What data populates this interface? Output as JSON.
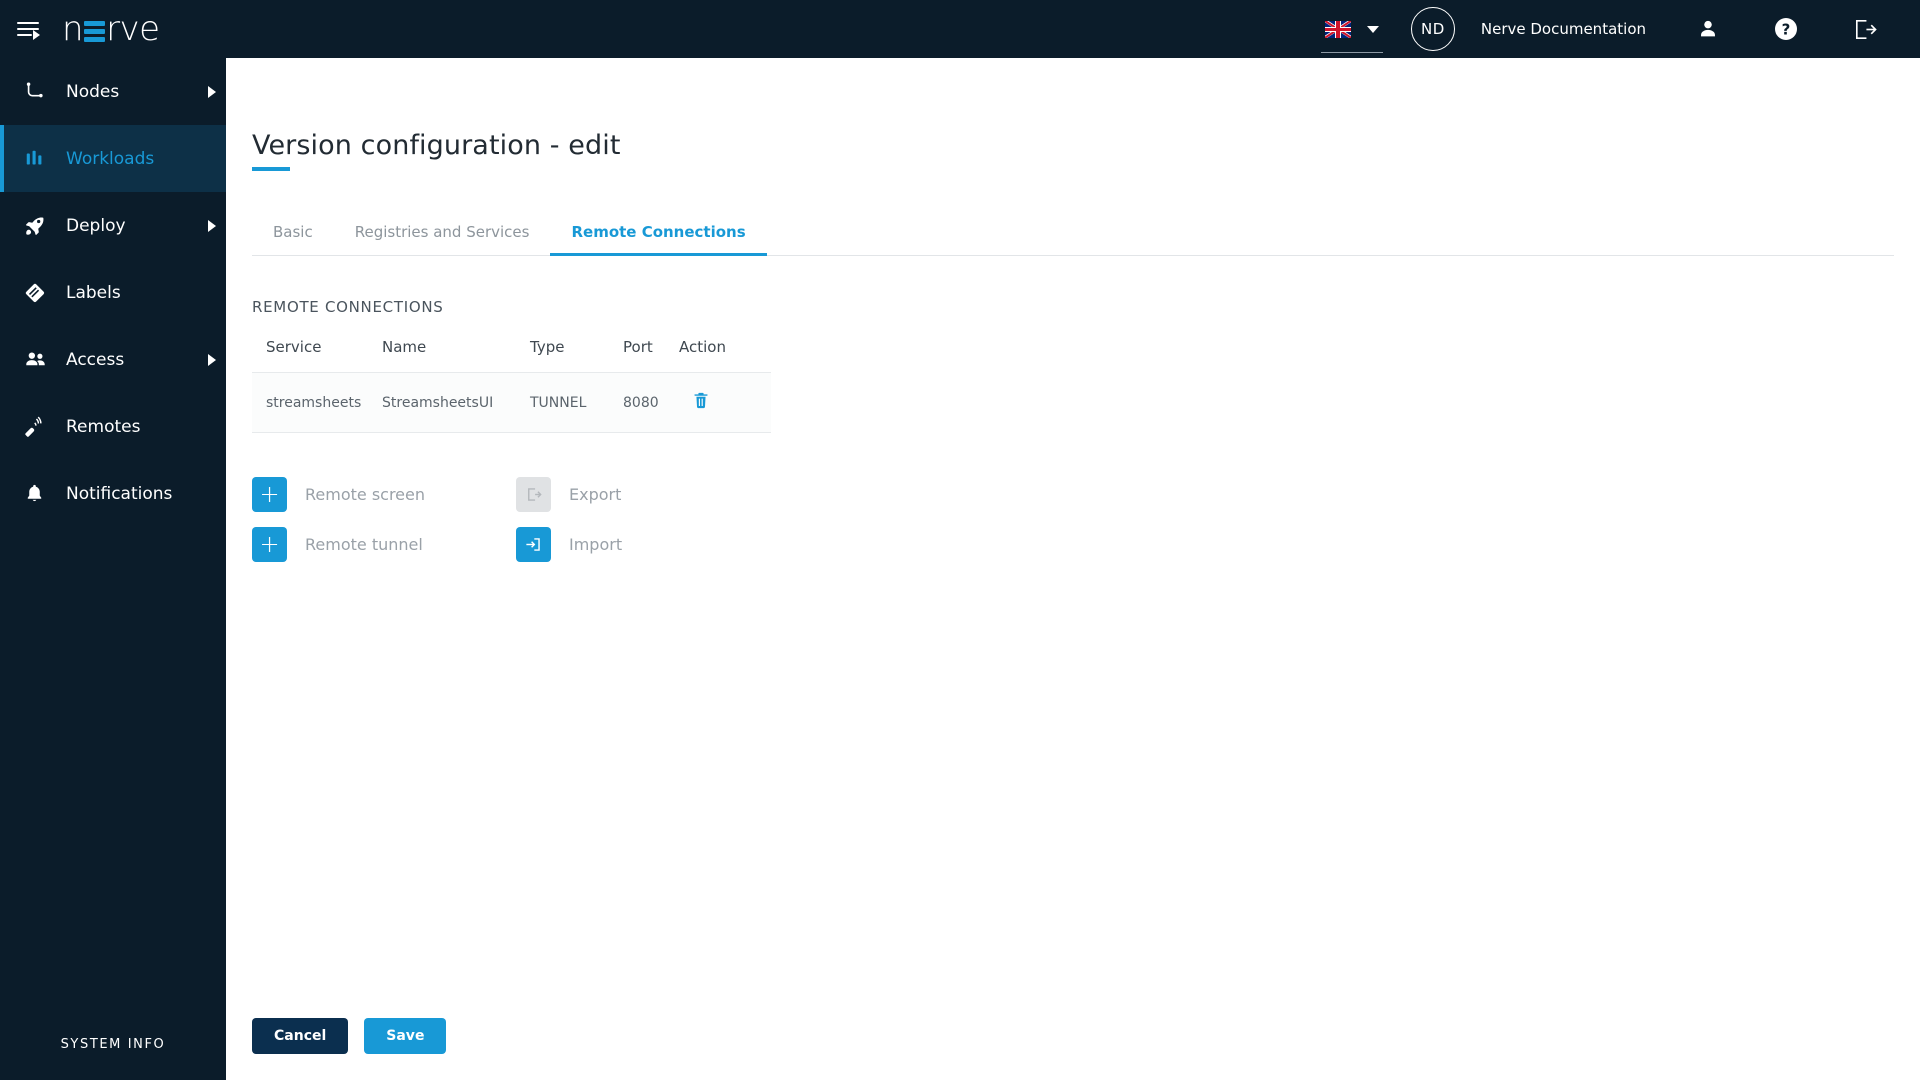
{
  "header": {
    "menu_icon": "hamburger-menu-icon",
    "logo_text_left": "n",
    "logo_text_right": "rve",
    "language_flag": "uk-flag-icon",
    "avatar_initials": "ND",
    "documentation_label": "Nerve Documentation",
    "profile_icon": "person-icon",
    "help_icon": "help-question-icon",
    "logout_icon": "logout-icon"
  },
  "sidebar": {
    "items": [
      {
        "label": "Nodes",
        "icon": "nodes-icon",
        "has_submenu": true,
        "active": false
      },
      {
        "label": "Workloads",
        "icon": "workloads-icon",
        "has_submenu": false,
        "active": true
      },
      {
        "label": "Deploy",
        "icon": "deploy-rocket-icon",
        "has_submenu": true,
        "active": false
      },
      {
        "label": "Labels",
        "icon": "labels-tag-icon",
        "has_submenu": false,
        "active": false
      },
      {
        "label": "Access",
        "icon": "access-users-icon",
        "has_submenu": true,
        "active": false
      },
      {
        "label": "Remotes",
        "icon": "remotes-icon",
        "has_submenu": false,
        "active": false
      },
      {
        "label": "Notifications",
        "icon": "bell-icon",
        "has_submenu": false,
        "active": false
      }
    ],
    "system_info_label": "SYSTEM INFO"
  },
  "main": {
    "page_title": "Version configuration - edit",
    "tabs": [
      {
        "label": "Basic",
        "active": false
      },
      {
        "label": "Registries and Services",
        "active": false
      },
      {
        "label": "Remote Connections",
        "active": true
      }
    ],
    "section_title": "REMOTE CONNECTIONS",
    "table": {
      "columns": [
        "Service",
        "Name",
        "Type",
        "Port",
        "Action"
      ],
      "rows": [
        {
          "service": "streamsheets",
          "name": "StreamsheetsUI",
          "type": "TUNNEL",
          "port": "8080",
          "action_icon": "trash-delete-icon"
        }
      ]
    },
    "actions": [
      {
        "label": "Remote screen",
        "icon": "plus-icon",
        "disabled": false
      },
      {
        "label": "Export",
        "icon": "export-icon",
        "disabled": true
      },
      {
        "label": "Remote tunnel",
        "icon": "plus-icon",
        "disabled": false
      },
      {
        "label": "Import",
        "icon": "import-icon",
        "disabled": false
      }
    ],
    "footer": {
      "cancel_label": "Cancel",
      "save_label": "Save"
    }
  },
  "colors": {
    "accent": "#1899d6",
    "dark_navy": "#0b1c2a",
    "cancel_navy": "#0b2f4f",
    "active_nav_bg": "#0d3047"
  }
}
